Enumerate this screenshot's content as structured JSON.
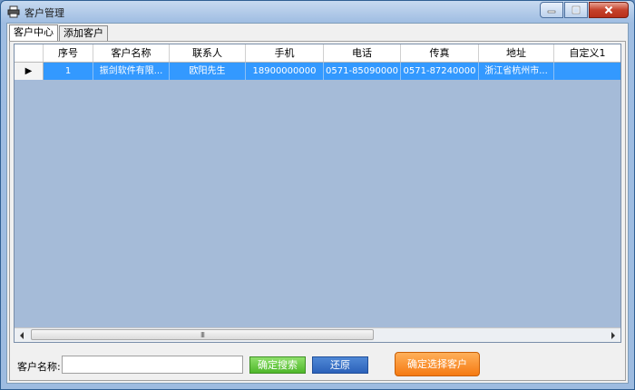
{
  "window": {
    "title": "客户管理"
  },
  "tabs": [
    {
      "label": "客户中心",
      "active": true
    },
    {
      "label": "添加客户",
      "active": false
    }
  ],
  "grid": {
    "columns": [
      "",
      "序号",
      "客户名称",
      "联系人",
      "手机",
      "电话",
      "传真",
      "地址",
      "自定义1"
    ],
    "rows": [
      [
        "▶",
        "1",
        "振剑软件有限...",
        "欧阳先生",
        "18900000000",
        "0571-85090000",
        "0571-87240000",
        "浙江省杭州市...",
        ""
      ]
    ],
    "scroll_thumb_grip": "III"
  },
  "search": {
    "label": "客户名称:",
    "value": "",
    "placeholder": ""
  },
  "buttons": {
    "search": "确定搜索",
    "reset": "还原",
    "confirm": "确定选择客户"
  },
  "colors": {
    "selection": "#3399ff",
    "grid_background": "#a5bbd8",
    "search_button": "#4fb72a",
    "reset_button": "#2c62ba",
    "confirm_button": "#f57a12"
  }
}
